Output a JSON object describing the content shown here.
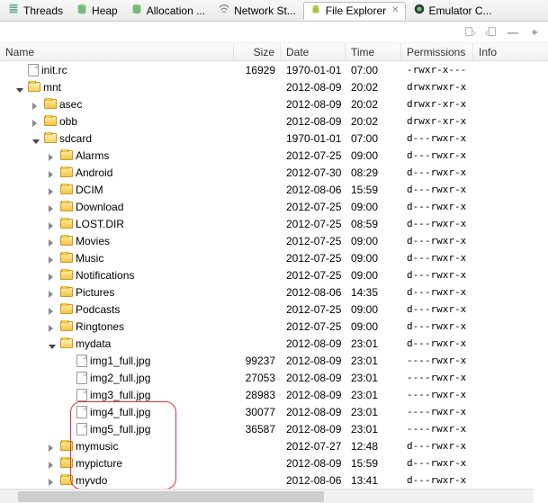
{
  "tabs": [
    {
      "label": "Threads",
      "icon": "threads"
    },
    {
      "label": "Heap",
      "icon": "db"
    },
    {
      "label": "Allocation ...",
      "icon": "db"
    },
    {
      "label": "Network St...",
      "icon": "wifi"
    },
    {
      "label": "File Explorer",
      "icon": "android",
      "active": true
    },
    {
      "label": "Emulator C...",
      "icon": "emulator"
    }
  ],
  "columns": {
    "name": "Name",
    "size": "Size",
    "date": "Date",
    "time": "Time",
    "perm": "Permissions",
    "info": "Info"
  },
  "rows": [
    {
      "depth": 0,
      "arrow": "none",
      "type": "file",
      "name": "init.rc",
      "size": "16929",
      "date": "1970-01-01",
      "time": "07:00",
      "perm": "-rwxr-x---"
    },
    {
      "depth": 0,
      "arrow": "down",
      "type": "folder-open",
      "name": "mnt",
      "size": "",
      "date": "2012-08-09",
      "time": "20:02",
      "perm": "drwxrwxr-x"
    },
    {
      "depth": 1,
      "arrow": "right",
      "type": "folder",
      "name": "asec",
      "size": "",
      "date": "2012-08-09",
      "time": "20:02",
      "perm": "drwxr-xr-x"
    },
    {
      "depth": 1,
      "arrow": "right",
      "type": "folder",
      "name": "obb",
      "size": "",
      "date": "2012-08-09",
      "time": "20:02",
      "perm": "drwxr-xr-x"
    },
    {
      "depth": 1,
      "arrow": "down",
      "type": "folder-open",
      "name": "sdcard",
      "size": "",
      "date": "1970-01-01",
      "time": "07:00",
      "perm": "d---rwxr-x"
    },
    {
      "depth": 2,
      "arrow": "right",
      "type": "folder",
      "name": "Alarms",
      "size": "",
      "date": "2012-07-25",
      "time": "09:00",
      "perm": "d---rwxr-x"
    },
    {
      "depth": 2,
      "arrow": "right",
      "type": "folder",
      "name": "Android",
      "size": "",
      "date": "2012-07-30",
      "time": "08:29",
      "perm": "d---rwxr-x"
    },
    {
      "depth": 2,
      "arrow": "right",
      "type": "folder",
      "name": "DCIM",
      "size": "",
      "date": "2012-08-06",
      "time": "15:59",
      "perm": "d---rwxr-x"
    },
    {
      "depth": 2,
      "arrow": "right",
      "type": "folder",
      "name": "Download",
      "size": "",
      "date": "2012-07-25",
      "time": "09:00",
      "perm": "d---rwxr-x"
    },
    {
      "depth": 2,
      "arrow": "right",
      "type": "folder",
      "name": "LOST.DIR",
      "size": "",
      "date": "2012-07-25",
      "time": "08:59",
      "perm": "d---rwxr-x"
    },
    {
      "depth": 2,
      "arrow": "right",
      "type": "folder",
      "name": "Movies",
      "size": "",
      "date": "2012-07-25",
      "time": "09:00",
      "perm": "d---rwxr-x"
    },
    {
      "depth": 2,
      "arrow": "right",
      "type": "folder",
      "name": "Music",
      "size": "",
      "date": "2012-07-25",
      "time": "09:00",
      "perm": "d---rwxr-x"
    },
    {
      "depth": 2,
      "arrow": "right",
      "type": "folder",
      "name": "Notifications",
      "size": "",
      "date": "2012-07-25",
      "time": "09:00",
      "perm": "d---rwxr-x"
    },
    {
      "depth": 2,
      "arrow": "right",
      "type": "folder",
      "name": "Pictures",
      "size": "",
      "date": "2012-08-06",
      "time": "14:35",
      "perm": "d---rwxr-x"
    },
    {
      "depth": 2,
      "arrow": "right",
      "type": "folder",
      "name": "Podcasts",
      "size": "",
      "date": "2012-07-25",
      "time": "09:00",
      "perm": "d---rwxr-x"
    },
    {
      "depth": 2,
      "arrow": "right",
      "type": "folder",
      "name": "Ringtones",
      "size": "",
      "date": "2012-07-25",
      "time": "09:00",
      "perm": "d---rwxr-x"
    },
    {
      "depth": 2,
      "arrow": "down",
      "type": "folder-open",
      "name": "mydata",
      "size": "",
      "date": "2012-08-09",
      "time": "23:01",
      "perm": "d---rwxr-x"
    },
    {
      "depth": 3,
      "arrow": "none",
      "type": "file",
      "name": "img1_full.jpg",
      "size": "99237",
      "date": "2012-08-09",
      "time": "23:01",
      "perm": "----rwxr-x"
    },
    {
      "depth": 3,
      "arrow": "none",
      "type": "file",
      "name": "img2_full.jpg",
      "size": "27053",
      "date": "2012-08-09",
      "time": "23:01",
      "perm": "----rwxr-x"
    },
    {
      "depth": 3,
      "arrow": "none",
      "type": "file",
      "name": "img3_full.jpg",
      "size": "28983",
      "date": "2012-08-09",
      "time": "23:01",
      "perm": "----rwxr-x"
    },
    {
      "depth": 3,
      "arrow": "none",
      "type": "file",
      "name": "img4_full.jpg",
      "size": "30077",
      "date": "2012-08-09",
      "time": "23:01",
      "perm": "----rwxr-x"
    },
    {
      "depth": 3,
      "arrow": "none",
      "type": "file",
      "name": "img5_full.jpg",
      "size": "36587",
      "date": "2012-08-09",
      "time": "23:01",
      "perm": "----rwxr-x"
    },
    {
      "depth": 2,
      "arrow": "right",
      "type": "folder",
      "name": "mymusic",
      "size": "",
      "date": "2012-07-27",
      "time": "12:48",
      "perm": "d---rwxr-x"
    },
    {
      "depth": 2,
      "arrow": "right",
      "type": "folder",
      "name": "mypicture",
      "size": "",
      "date": "2012-08-09",
      "time": "15:59",
      "perm": "d---rwxr-x"
    },
    {
      "depth": 2,
      "arrow": "right",
      "type": "folder",
      "name": "myvdo",
      "size": "",
      "date": "2012-08-06",
      "time": "13:41",
      "perm": "d---rwxr-x"
    }
  ]
}
